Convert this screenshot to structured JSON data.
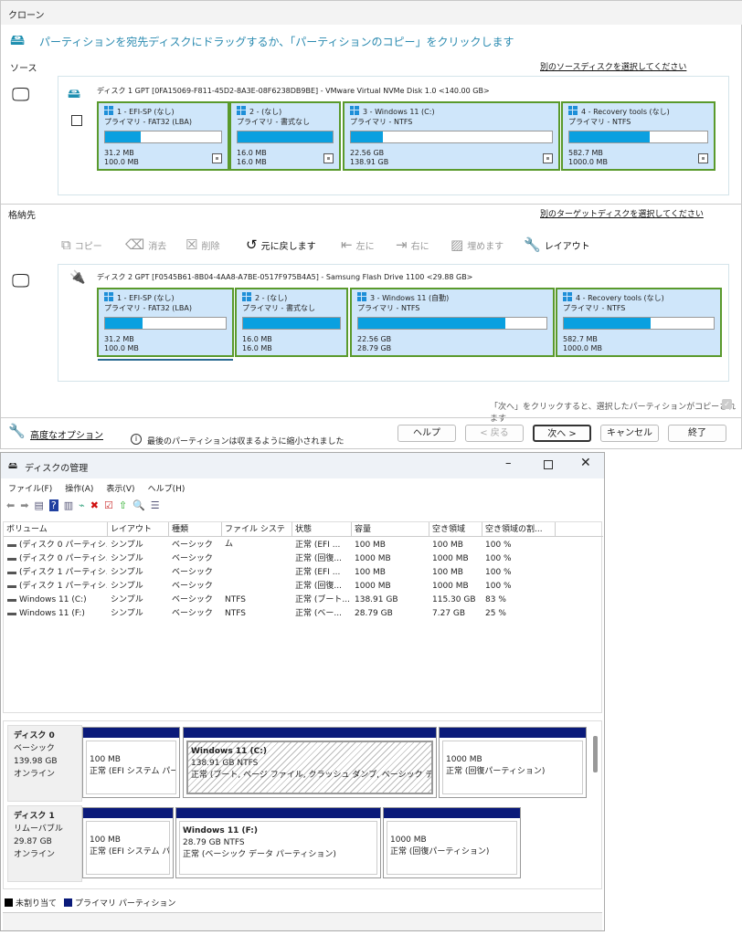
{
  "clone": {
    "title": "クローン",
    "instruction": "パーティションを宛先ディスクにドラッグするか、「パーティションのコピー」をクリックします",
    "source_label": "ソース",
    "select_source_link": "別のソースディスクを選択してください",
    "source_disk": {
      "info": "ディスク 1 GPT [0FA15069-F811-45D2-8A3E-08F6238DB9BE] - VMware Virtual NVMe Disk 1.0  <140.00 GB>",
      "partitions": [
        {
          "name": "1 - EFI-SP (なし)",
          "type": "プライマリ - FAT32 (LBA)",
          "used": "31.2 MB",
          "total": "100.0 MB",
          "fill": 0.31
        },
        {
          "name": "2 -  (なし)",
          "type": "プライマリ - 書式なし",
          "used": "16.0 MB",
          "total": "16.0 MB",
          "fill": 1.0
        },
        {
          "name": "3 - Windows 11 (C:)",
          "type": "プライマリ - NTFS",
          "used": "22.56 GB",
          "total": "138.91 GB",
          "fill": 0.16
        },
        {
          "name": "4 - Recovery tools (なし)",
          "type": "プライマリ - NTFS",
          "used": "582.7 MB",
          "total": "1000.0 MB",
          "fill": 0.58
        }
      ]
    },
    "target_label": "格納先",
    "select_target_link": "別のターゲットディスクを選択してください",
    "toolbar": [
      {
        "label": "コピー",
        "icon": "copy-icon",
        "glyph": "⧉",
        "enabled": false
      },
      {
        "label": "消去",
        "icon": "erase-icon",
        "glyph": "⌫",
        "enabled": false
      },
      {
        "label": "削除",
        "icon": "delete-icon",
        "glyph": "☒",
        "enabled": false
      },
      {
        "label": "元に戻します",
        "icon": "undo-icon",
        "glyph": "↺",
        "enabled": true
      },
      {
        "label": "左に",
        "icon": "move-left-icon",
        "glyph": "⇤",
        "enabled": false
      },
      {
        "label": "右に",
        "icon": "move-right-icon",
        "glyph": "⇥",
        "enabled": false
      },
      {
        "label": "埋めます",
        "icon": "fill-icon",
        "glyph": "▨",
        "enabled": false
      },
      {
        "label": "レイアウト",
        "icon": "wrench-icon",
        "glyph": "🔧",
        "enabled": true
      }
    ],
    "target_disk": {
      "info": "ディスク 2 GPT [F0545B61-8B04-4AA8-A7BE-0517F975B4A5] - Samsung  Flash Drive     1100  <29.88 GB>",
      "partitions": [
        {
          "name": "1 - EFI-SP (なし)",
          "type": "プライマリ - FAT32 (LBA)",
          "used": "31.2 MB",
          "total": "100.0 MB",
          "fill": 0.31
        },
        {
          "name": "2 -  (なし)",
          "type": "プライマリ - 書式なし",
          "used": "16.0 MB",
          "total": "16.0 MB",
          "fill": 1.0
        },
        {
          "name": "3 - Windows 11 (自動)",
          "type": "プライマリ - NTFS",
          "used": "22.56 GB",
          "total": "28.79 GB",
          "fill": 0.78
        },
        {
          "name": "4 - Recovery tools (なし)",
          "type": "プライマリ - NTFS",
          "used": "582.7 MB",
          "total": "1000.0 MB",
          "fill": 0.58
        }
      ]
    },
    "copy_note": "「次へ」をクリックすると、選択したパーティションがコピーされます",
    "advanced_options": "高度なオプション",
    "shrink_note": "最後のパーティションは収まるように縮小されました",
    "buttons": {
      "help": "ヘルプ",
      "back": "< 戻る",
      "next": "次へ >",
      "cancel": "キャンセル",
      "finish": "終了"
    }
  },
  "dm": {
    "title": "ディスクの管理",
    "menu": [
      "ファイル(F)",
      "操作(A)",
      "表示(V)",
      "ヘルプ(H)"
    ],
    "columns": [
      "ボリューム",
      "レイアウト",
      "種類",
      "ファイル システム",
      "状態",
      "容量",
      "空き領域",
      "空き領域の割..."
    ],
    "rows": [
      [
        "(ディスク 0 パーティシ...",
        "シンプル",
        "ベーシック",
        "",
        "正常 (EFI ...",
        "100 MB",
        "100 MB",
        "100 %"
      ],
      [
        "(ディスク 0 パーティシ...",
        "シンプル",
        "ベーシック",
        "",
        "正常 (回復...",
        "1000 MB",
        "1000 MB",
        "100 %"
      ],
      [
        "(ディスク 1 パーティシ...",
        "シンプル",
        "ベーシック",
        "",
        "正常 (EFI ...",
        "100 MB",
        "100 MB",
        "100 %"
      ],
      [
        "(ディスク 1 パーティシ...",
        "シンプル",
        "ベーシック",
        "",
        "正常 (回復...",
        "1000 MB",
        "1000 MB",
        "100 %"
      ],
      [
        "Windows 11 (C:)",
        "シンプル",
        "ベーシック",
        "NTFS",
        "正常 (ブート...",
        "138.91 GB",
        "115.30 GB",
        "83 %"
      ],
      [
        "Windows 11 (F:)",
        "シンプル",
        "ベーシック",
        "NTFS",
        "正常 (ベー...",
        "28.79 GB",
        "7.27 GB",
        "25 %"
      ]
    ],
    "disks": [
      {
        "name": "ディスク 0",
        "type": "ベーシック",
        "size": "139.98 GB",
        "status": "オンライン",
        "volumes": [
          {
            "title": "",
            "line1": "100 MB",
            "line2": "正常 (EFI システム パー"
          },
          {
            "title": "Windows 11  (C:)",
            "line1": "138.91 GB NTFS",
            "line2": "正常 (ブート, ページ ファイル, クラッシュ ダンプ, ベーシック データ パー"
          },
          {
            "title": "",
            "line1": "1000 MB",
            "line2": "正常 (回復パーティション)"
          }
        ]
      },
      {
        "name": "ディスク 1",
        "type": "リムーバブル",
        "size": "29.87 GB",
        "status": "オンライン",
        "volumes": [
          {
            "title": "",
            "line1": "100 MB",
            "line2": "正常 (EFI システム パ"
          },
          {
            "title": "Windows 11  (F:)",
            "line1": "28.79 GB NTFS",
            "line2": "正常 (ベーシック データ パーティション)"
          },
          {
            "title": "",
            "line1": "1000 MB",
            "line2": "正常 (回復パーティション)"
          }
        ]
      }
    ],
    "legend": [
      {
        "label": "未割り当て",
        "color": "#000000"
      },
      {
        "label": "プライマリ パーティション",
        "color": "#0a1a7a"
      }
    ]
  }
}
